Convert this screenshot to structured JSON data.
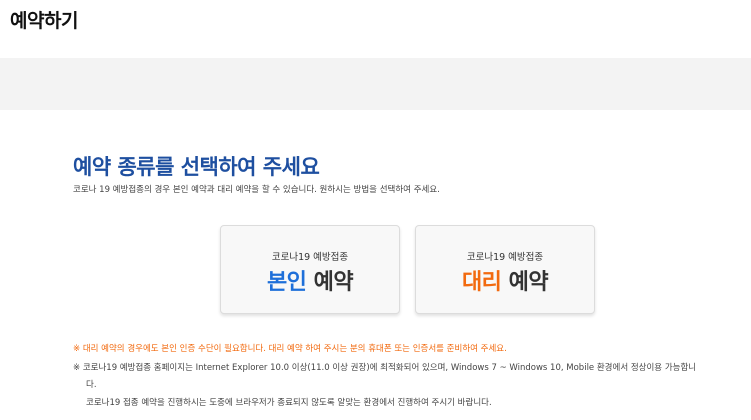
{
  "page": {
    "title": "예약하기"
  },
  "main": {
    "headline": "예약 종류를 선택하여 주세요",
    "subtitle": "코로나 19 예방접종의 경우 본인 예약과 대리 예약을 할 수 있습니다. 원하시는 방법을 선택하여 주세요."
  },
  "cards": {
    "self": {
      "caption": "코로나19 예방접종",
      "accent": "본인",
      "rest": " 예약"
    },
    "proxy": {
      "caption": "코로나19 예방접종",
      "accent": "대리",
      "rest": " 예약"
    }
  },
  "notices": {
    "warning": "※ 대리 예약의 경우에도 본인 인증 수단이 필요합니다. 대리 예약 하여 주시는 분의 휴대폰 또는 인증서를 준비하여 주세요.",
    "browser_line1": "※ 코로나19 예방접종 홈페이지는 Internet Explorer 10.0 이상(11.0 이상 권장)에 최적화되어 있으며, Windows 7 ~ Windows 10, Mobile 환경에서 정상이용 가능합니",
    "browser_line2": "다.",
    "session": "코로나19 접종 예약을 진행하시는 도중에 브라우저가 종료되지 않도록 알맞는 환경에서 진행하여 주시기 바랍니다."
  },
  "colors": {
    "headline": "#1e4fa0",
    "self_accent": "#1e6fd9",
    "proxy_accent": "#f26a0f",
    "warning_text": "#f26a0f",
    "band": "#f3f3f3"
  }
}
